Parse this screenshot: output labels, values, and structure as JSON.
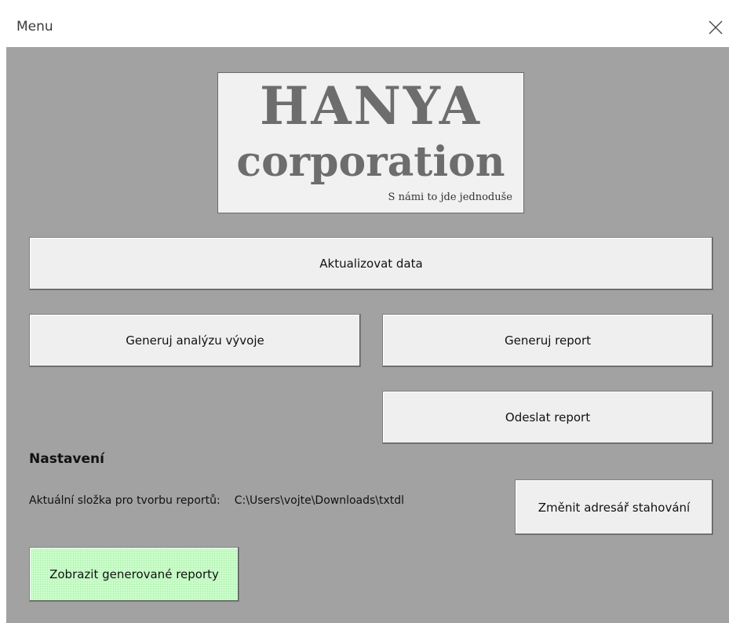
{
  "window": {
    "title": "Menu",
    "close_icon": "close-icon"
  },
  "logo": {
    "line1": "HANYA",
    "line2": "corporation",
    "tagline": "S námi to jde jednoduše"
  },
  "buttons": {
    "update_data": "Aktualizovat data",
    "generate_analysis": "Generuj analýzu vývoje",
    "generate_report": "Generuj report",
    "send_report": "Odeslat report",
    "change_directory": "Změnit adresář stahování",
    "show_reports": "Zobrazit generované reporty"
  },
  "settings": {
    "heading": "Nastavení",
    "folder_label": "Aktuální složka pro tvorbu reportů:",
    "folder_path": "C:\\Users\\vojte\\Downloads\\txtdl"
  },
  "colors": {
    "background": "#a2a2a2",
    "button": "#efefef",
    "show_reports_button": "#ccffcc"
  }
}
